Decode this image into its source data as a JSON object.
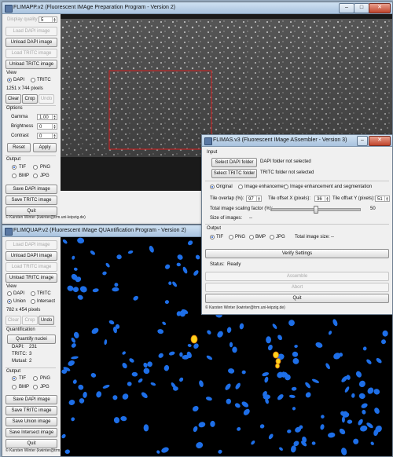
{
  "flimapp": {
    "title": "FLIMAPP.v2 (Fluorescent IMAge Preparation Program - Version 2)",
    "display_quality_label": "Display quality",
    "display_quality_value": "5",
    "load_dapi": "Load DAPI image",
    "unload_dapi": "Unload DAPI image",
    "load_tritc": "Load TRITC image",
    "unload_tritc": "Unload TRITC image",
    "view_label": "View",
    "view_dapi": "DAPI",
    "view_tritc": "TRITC",
    "image_size": "1251 x 744 pixels",
    "clear": "Clear",
    "crop": "Crop",
    "undo": "Undo",
    "options_label": "Options",
    "gamma_label": "Gamma",
    "gamma_value": "1.00",
    "brightness_label": "Brightness",
    "brightness_value": "0",
    "contrast_label": "Contrast",
    "contrast_value": "0",
    "reset": "Reset",
    "apply": "Apply",
    "output_label": "Output",
    "tif": "TIF",
    "png": "PNG",
    "bmp": "BMP",
    "jpg": "JPG",
    "save_dapi": "Save DAPI image",
    "save_tritc": "Save TRITC image",
    "quit": "Quit",
    "footer": "© Karsten Winter (kwinter@trm.uni-leipzig.de)"
  },
  "flimquap": {
    "title": "FLIMQUAP.v2 (Fluorescent IMage QUAntification Program - Version 2)",
    "load_dapi": "Load DAPI image",
    "unload_dapi": "Unload DAPI image",
    "load_tritc": "Load TRITC image",
    "unload_tritc": "Unload TRITC image",
    "view_label": "View",
    "view_dapi": "DAPI",
    "view_tritc": "TRITC",
    "view_union": "Union",
    "view_intersect": "Intersect",
    "image_size": "782 x 454 pixels",
    "clear": "Clear",
    "crop": "Crop",
    "undo": "Undo",
    "quant_label": "Quantification",
    "quantify": "Quantify nuclei",
    "dapi_label": "DAPI:",
    "dapi_value": "231",
    "tritc_label": "TRITC:",
    "tritc_value": "3",
    "mutual_label": "Mutual:",
    "mutual_value": "2",
    "output_label": "Output",
    "tif": "TIF",
    "png": "PNG",
    "bmp": "BMP",
    "jpg": "JPG",
    "save_dapi": "Save DAPI image",
    "save_tritc": "Save TRITC image",
    "save_union": "Save Union image",
    "save_intersect": "Save Intersect image",
    "quit": "Quit",
    "footer": "© Karsten Winter (kwinter@trm.uni-leipzig.de)"
  },
  "flimas": {
    "title": "FLIMAS.v3 (Fluorescent IMage ASsembler - Version 3)",
    "input_label": "Input",
    "select_dapi": "Select DAPI folder",
    "dapi_status": "DAPI folder not selected",
    "select_tritc": "Select TRITC folder",
    "tritc_status": "TRITC folder not selected",
    "mode_original": "Original",
    "mode_enh": "Image enhancement",
    "mode_enh_seg": "Image enhancement and segmentation",
    "overlap_label": "Tile overlap (%):",
    "overlap_value": "97",
    "offx_label": "Tile offset X (pixels):",
    "offx_value": "36",
    "offy_label": "Tile offset Y (pixels):",
    "offy_value": "51",
    "scale_label": "Total image scaling factor (%):",
    "scale_value": "50",
    "scale_fraction": 0.5,
    "size_label": "Size of images:",
    "size_value": "--",
    "output_label": "Output",
    "tif": "TIF",
    "png": "PNG",
    "bmp": "BMP",
    "jpg": "JPG",
    "total_size_label": "Total image size:",
    "total_size_value": "--",
    "verify": "Verify Settings",
    "status_label": "Status:",
    "status_value": "Ready",
    "assemble": "Assemble",
    "abort": "Abort",
    "quit": "Quit",
    "footer": "© Karsten Winter (kwinter@trm.uni-leipzig.de)"
  },
  "colors": {
    "nuclei_blue": "#1e6fe8",
    "mutual_yellow": "#ffd21a",
    "selection_red": "#d81e1e"
  }
}
